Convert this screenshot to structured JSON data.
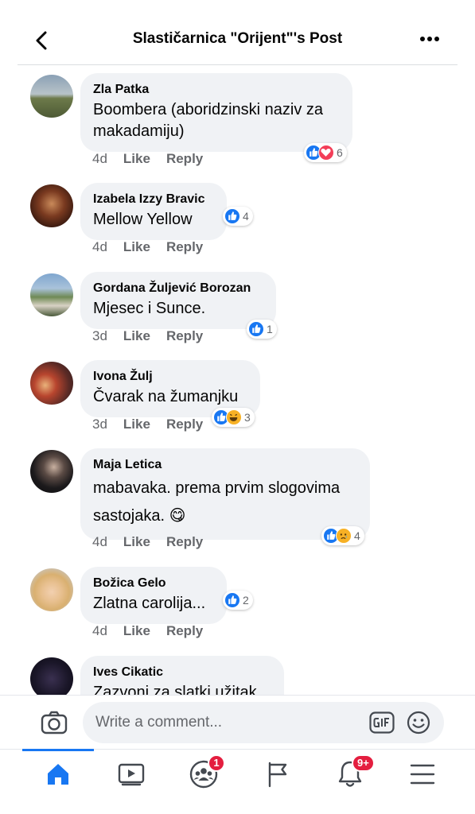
{
  "header": {
    "title": "Slastičarnica \"Orijent\"'s Post",
    "back_icon": "back-arrow-icon",
    "more_icon": "more-dots-icon"
  },
  "actions": {
    "like": "Like",
    "reply": "Reply"
  },
  "comments": [
    {
      "author": "Zla Patka",
      "text": "Boombera (aboridzinski naziv za makadamiju)",
      "time": "4d",
      "reactions": [
        "like",
        "love"
      ],
      "reaction_count": "6"
    },
    {
      "author": "Izabela Izzy Bravic",
      "text": "Mellow Yellow",
      "time": "4d",
      "reactions": [
        "like"
      ],
      "reaction_count": "4"
    },
    {
      "author": "Gordana Žuljević Borozan",
      "text": "Mjesec i Sunce.",
      "time": "3d",
      "reactions": [
        "like"
      ],
      "reaction_count": "1"
    },
    {
      "author": "Ivona Žulj",
      "text": "Čvarak na žumanjku",
      "time": "3d",
      "reactions": [
        "like",
        "haha"
      ],
      "reaction_count": "3"
    },
    {
      "author": "Maja Letica",
      "text": "mabavaka. prema prvim slogovima sastojaka. 😋",
      "time": "4d",
      "reactions": [
        "like",
        "sad"
      ],
      "reaction_count": "4"
    },
    {
      "author": "Božica Gelo",
      "text": "Zlatna carolija...",
      "time": "4d",
      "reactions": [
        "like"
      ],
      "reaction_count": "2"
    },
    {
      "author": "Ives Cikatic",
      "text": "Zazvoni za slatki užitak",
      "time": "",
      "reactions": [],
      "reaction_count": ""
    }
  ],
  "composer": {
    "placeholder": "Write a comment...",
    "camera_icon": "camera-icon",
    "gif_icon": "gif-icon",
    "emoji_icon": "emoji-icon"
  },
  "tabbar": {
    "tabs": [
      {
        "name": "home",
        "icon": "home-icon",
        "badge": ""
      },
      {
        "name": "watch",
        "icon": "video-play-icon",
        "badge": ""
      },
      {
        "name": "groups",
        "icon": "groups-icon",
        "badge": "1"
      },
      {
        "name": "pages",
        "icon": "flag-icon",
        "badge": ""
      },
      {
        "name": "notifications",
        "icon": "bell-icon",
        "badge": "9+"
      },
      {
        "name": "menu",
        "icon": "hamburger-menu-icon",
        "badge": ""
      }
    ]
  },
  "colors": {
    "accent": "#1877f2",
    "bubble": "#f0f2f5",
    "secondary_text": "#65676b",
    "badge": "#e41e3f",
    "love": "#f33e58",
    "emoji_yellow": "#f7b125"
  }
}
